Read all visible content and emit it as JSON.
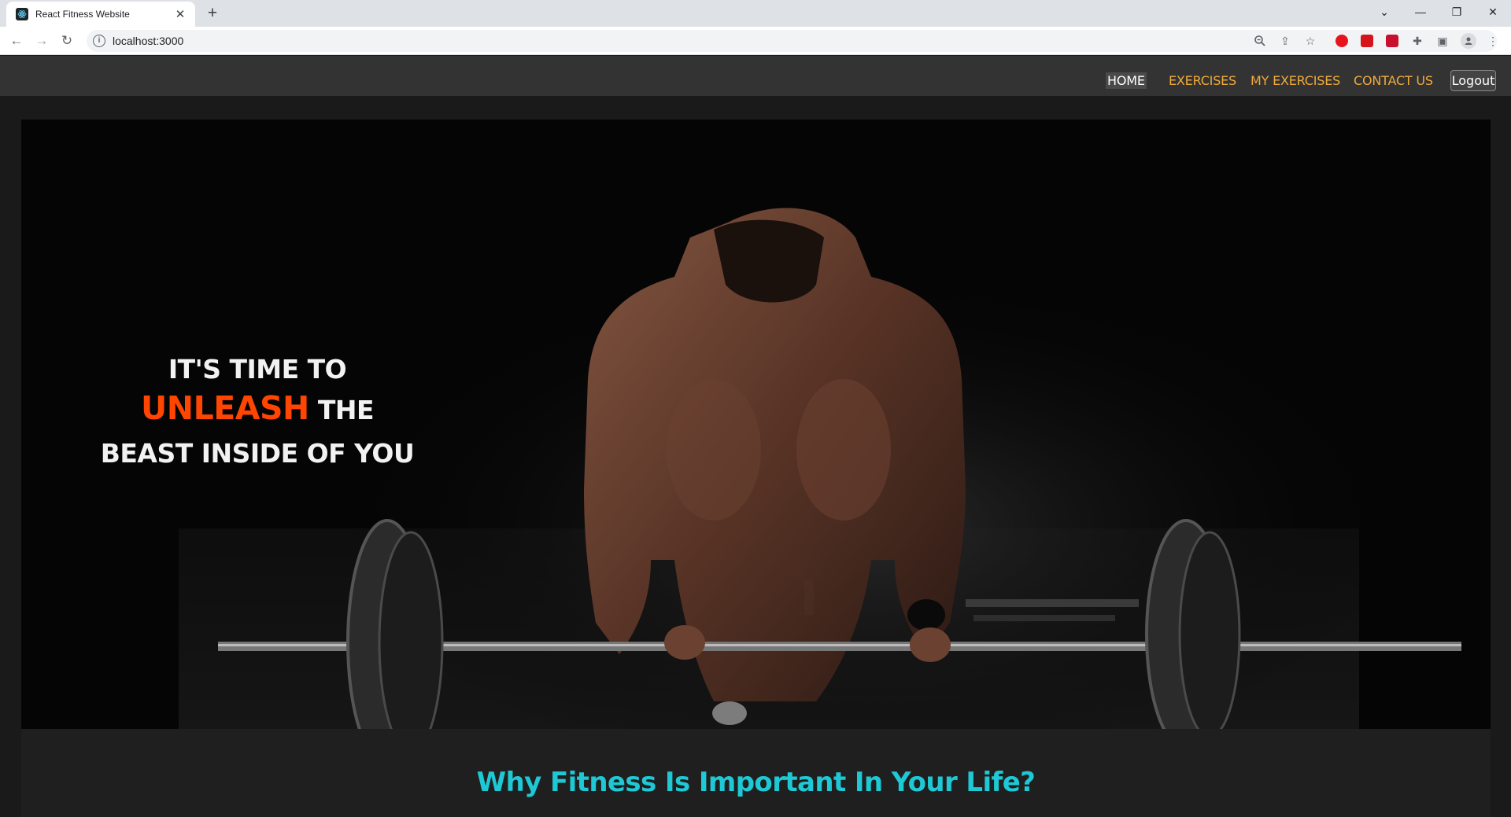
{
  "browser": {
    "tab_title": "React Fitness Website",
    "tab_close_icon": "close-icon",
    "new_tab_icon": "plus-icon",
    "url": "localhost:3000",
    "window_controls": [
      "chevron-down-icon",
      "minimize-icon",
      "restore-icon",
      "close-icon"
    ],
    "toolbar_icons": [
      "zoom-icon",
      "share-icon",
      "star-icon",
      "opera-extension-icon",
      "red-extension-icon",
      "red-extension-2-icon",
      "puzzle-icon",
      "side-panel-icon",
      "profile-icon",
      "more-icon"
    ]
  },
  "nav": {
    "links": [
      {
        "label": "HOME",
        "active": true
      },
      {
        "label": "EXERCISES",
        "active": false
      },
      {
        "label": "MY EXERCISES",
        "active": false
      },
      {
        "label": "CONTACT US",
        "active": false
      }
    ],
    "logout_label": "Logout"
  },
  "hero": {
    "line1": "IT'S TIME TO",
    "accent": "UNLEASH",
    "line2_rest": "THE",
    "line3": "BEAST INSIDE OF YOU"
  },
  "section": {
    "heading": "Why Fitness Is Important In Your Life?"
  },
  "colors": {
    "accent_orange": "#ff4500",
    "nav_link": "#f0a93b",
    "heading_cyan": "#1ec8d4",
    "navbar_bg": "#333333"
  }
}
